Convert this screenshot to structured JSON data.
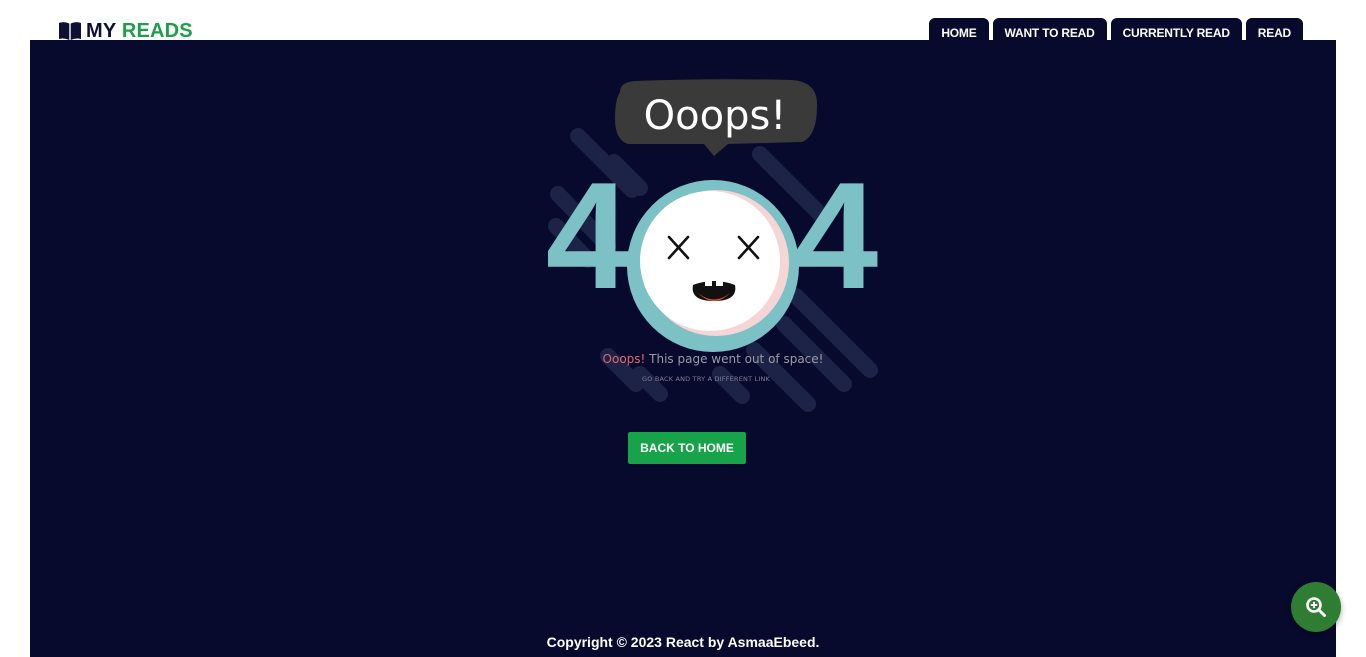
{
  "brand": {
    "prefix": "MY",
    "accent": "READS",
    "icon": "open-book-icon"
  },
  "nav": {
    "items": [
      {
        "label": "HOME"
      },
      {
        "label": "WANT TO READ"
      },
      {
        "label": "CURRENTLY READ"
      },
      {
        "label": "READ"
      }
    ]
  },
  "error": {
    "bubble": "Ooops!",
    "code_left": "4",
    "code_right": "4",
    "headline_accent": "Ooops!",
    "headline": " This page went out of space!",
    "subline": "GO BACK AND TRY A DIFFERENT LINK"
  },
  "actions": {
    "back_label": "BACK TO HOME"
  },
  "footer": {
    "copyright": "Copyright © 2023 React by AsmaaEbeed."
  },
  "fab": {
    "icon": "zoom-in-icon"
  },
  "colors": {
    "background": "#070a2d",
    "brand_accent": "#1e9e4a",
    "button": "#16a34a",
    "teal": "#7cc1c6",
    "fab": "#2e7d32",
    "headline_accent": "#e06a6a"
  }
}
